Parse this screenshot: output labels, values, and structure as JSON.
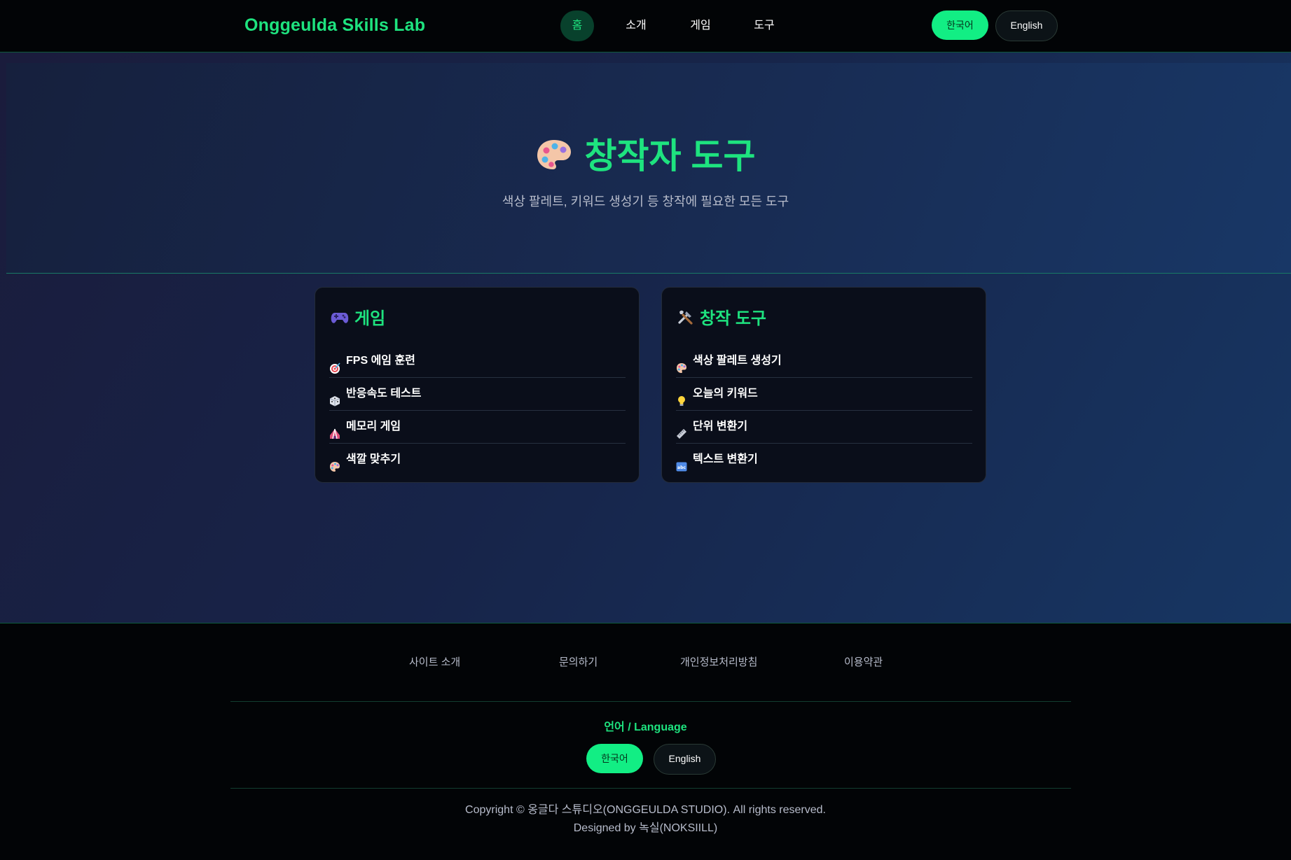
{
  "header": {
    "brand": "Onggeulda Skills Lab",
    "nav": [
      {
        "label": "홈"
      },
      {
        "label": "소개"
      },
      {
        "label": "게임"
      },
      {
        "label": "도구"
      }
    ],
    "lang_ko": "한국어",
    "lang_en": "English"
  },
  "hero": {
    "icon": "palette-icon",
    "title": "창작자 도구",
    "subtitle": "색상 팔레트, 키워드 생성기 등 창작에 필요한 모든 도구"
  },
  "cards": {
    "games": {
      "icon": "gamepad-icon",
      "title": "게임",
      "items": [
        {
          "icon": "target-icon",
          "label": "FPS 에임 훈련"
        },
        {
          "icon": "dice-icon",
          "label": "반응속도 테스트"
        },
        {
          "icon": "circus-tent-icon",
          "label": "메모리 게임"
        },
        {
          "icon": "palette-icon",
          "label": "색깔 맞추기"
        }
      ]
    },
    "tools": {
      "icon": "tools-icon",
      "title": "창작 도구",
      "items": [
        {
          "icon": "palette-icon",
          "label": "색상 팔레트 생성기"
        },
        {
          "icon": "lightbulb-icon",
          "label": "오늘의 키워드"
        },
        {
          "icon": "ruler-icon",
          "label": "단위 변환기"
        },
        {
          "icon": "abc-icon",
          "label": "텍스트 변환기"
        }
      ]
    }
  },
  "footer": {
    "links": [
      "사이트 소개",
      "문의하기",
      "개인정보처리방침",
      "이용약관"
    ],
    "lang_label": "언어 / Language",
    "lang_ko": "한국어",
    "lang_en": "English",
    "copyright": "Copyright © 옹글다 스튜디오(ONGGEULDA STUDIO). All rights reserved.",
    "designed_by": "Designed by 녹실(NOKSIILL)"
  },
  "colors": {
    "accent": "#1ee37f",
    "header_bg": "#020406",
    "card_bg": "#0a0e1a"
  }
}
